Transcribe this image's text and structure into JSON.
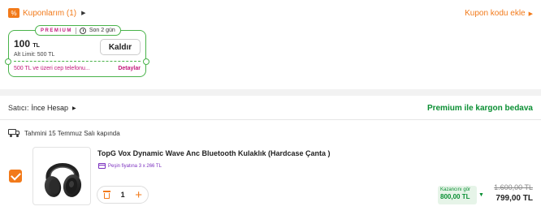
{
  "coupons": {
    "title": "Kuponlarım (1)",
    "add_label": "Kupon kodu ekle",
    "card": {
      "badge": "PREMIUM",
      "time_left": "Son 2 gün",
      "amount": "100",
      "currency": "TL",
      "limit": "Alt Limit: 500 TL",
      "remove_label": "Kaldır",
      "condition": "500 TL ve üzeri cep telefonu...",
      "details_label": "Detaylar"
    }
  },
  "seller": {
    "prefix": "Satıcı:",
    "name": "İnce Hesap",
    "free_shipping": "Premium ile kargon bedava"
  },
  "delivery": {
    "text": "Tahmini 15 Temmuz Salı kapında"
  },
  "product": {
    "name": "TopG Vox Dynamic Wave Anc Bluetooth Kulaklık (Hardcase Çanta )",
    "installment": "Peşin fiyatına 3 x 266 TL",
    "quantity": "1",
    "earn_label": "Kazancını gör",
    "earn_amount": "800,00 TL",
    "old_price": "1.600,00 TL",
    "new_price": "799,00 TL",
    "selected": true
  },
  "colors": {
    "accent": "#f27a1a",
    "green": "#0a8f33",
    "premium": "#c2187b",
    "installment": "#7b2fbf"
  },
  "icons": [
    "coupon-icon",
    "chevron-right-icon",
    "clock-icon",
    "truck-icon",
    "checkbox-icon",
    "trash-icon",
    "plus-icon",
    "chevron-down-icon",
    "card-icon"
  ]
}
